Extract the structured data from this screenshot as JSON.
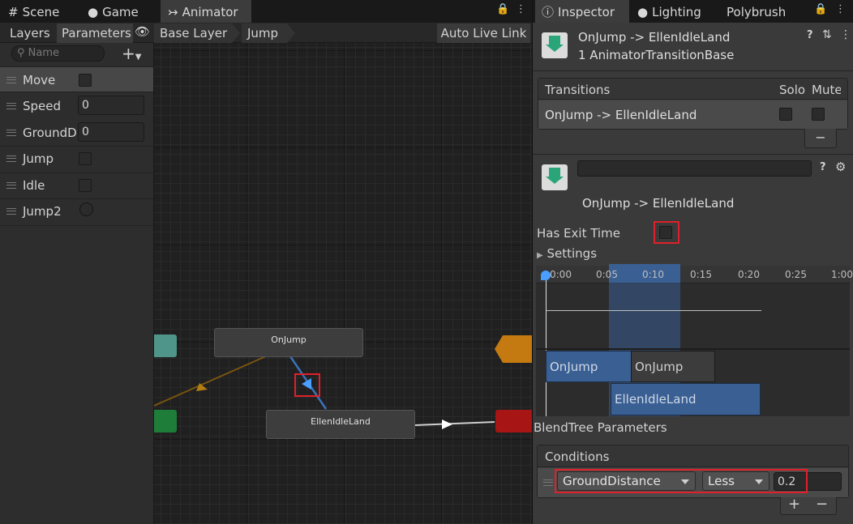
{
  "tabs_left": {
    "scene": "Scene",
    "game": "Game",
    "animator": "Animator"
  },
  "animator": {
    "subtabs": {
      "layers": "Layers",
      "parameters": "Parameters"
    },
    "search_placeholder": "Name",
    "breadcrumb": {
      "base": "Base Layer",
      "sub": "Jump"
    },
    "auto_live_link": "Auto Live Link",
    "parameters": [
      {
        "name": "Move",
        "kind": "bool"
      },
      {
        "name": "Speed",
        "kind": "float",
        "value": "0"
      },
      {
        "name": "GroundDi",
        "kind": "float",
        "value": "0"
      },
      {
        "name": "Jump",
        "kind": "bool"
      },
      {
        "name": "Idle",
        "kind": "bool"
      },
      {
        "name": "Jump2",
        "kind": "trigger"
      }
    ],
    "nodes": {
      "onjump": "OnJump",
      "ellen": "EllenIdleLand"
    }
  },
  "inspector": {
    "tabs": {
      "inspector": "Inspector",
      "lighting": "Lighting",
      "polybrush": "Polybrush"
    },
    "title": "OnJump -> EllenIdleLand",
    "subtitle": "1 AnimatorTransitionBase",
    "transitions_header": {
      "label": "Transitions",
      "solo": "Solo",
      "mute": "Mute"
    },
    "transition_row": "OnJump -> EllenIdleLand",
    "transition_name": "OnJump -> EllenIdleLand",
    "has_exit_time_label": "Has Exit Time",
    "has_exit_time": false,
    "settings_label": "Settings",
    "timeline": {
      "ticks": [
        "0:00",
        "0:05",
        "0:10",
        "0:15",
        "0:20",
        "0:25",
        "1:00"
      ],
      "clips": {
        "source_a": "OnJump",
        "source_b": "OnJump",
        "dest": "EllenIdleLand"
      }
    },
    "blendtree_label": "BlendTree Parameters",
    "conditions_label": "Conditions",
    "condition": {
      "parameter": "GroundDistance",
      "mode": "Less",
      "value": "0.2"
    }
  },
  "colors": {
    "accent": "#3a5f93",
    "highlight": "#e0202a",
    "orange": "#c47a10",
    "green": "#1f7d3a",
    "red": "#a71515",
    "teal": "#4f958a"
  }
}
